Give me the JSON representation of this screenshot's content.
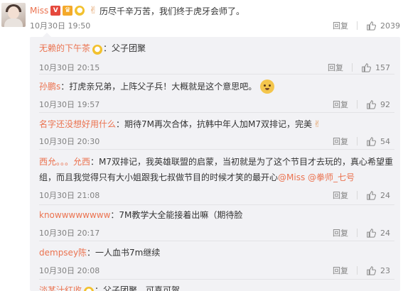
{
  "main_comment": {
    "user": "Miss",
    "text": "历尽千辛万苦，我们终于虎牙会师了。",
    "time": "10月30日 19:50",
    "reply_label": "回复",
    "likes": "2039",
    "badge_v": "V"
  },
  "replies": [
    {
      "user": "无赖的下午茶",
      "text": "：父子团聚",
      "time": "10月30日 20:15",
      "reply_label": "回复",
      "likes": "157"
    },
    {
      "user": "孙鹏s",
      "text": "：打虎亲兄弟，上阵父子兵！大概就是这个意思吧。",
      "time": "10月30日 19:57",
      "reply_label": "回复",
      "likes": "92"
    },
    {
      "user": "名字还没想好用什么",
      "text": "：期待7M再次合体，抗韩中年人加M7双排记，完美",
      "time": "10月30日 20:30",
      "reply_label": "回复",
      "likes": "54"
    },
    {
      "user": "西允。。。允西",
      "text_line1": "：M7双排记，我英雄联盟的启蒙，当初就是为了这个节目才去玩的，真心希望重",
      "text_line2": "组，而且我觉得只有大小姐跟我七叔做节目的时候才笑的最开心",
      "mention1": "@Miss",
      "mention2": "@拳师_七号",
      "time": "10月30日 21:08",
      "reply_label": "回复",
      "likes": "24"
    },
    {
      "user": "knowwwwwwww",
      "text": "：7M教学大全能接着出嘛（期待脸",
      "time": "10月30日 20:17",
      "reply_label": "回复",
      "likes": "24"
    },
    {
      "user": "dempsey陈",
      "text": "：一人血书7m继续",
      "time": "10月30日 20:08",
      "reply_label": "回复",
      "likes": "23"
    },
    {
      "user": "淡某汁红收",
      "text": "：父子团聚，可喜可贺"
    }
  ],
  "icons": {
    "thumb": "thumbs-up-icon",
    "emoji_victory": "victory-hand-icon",
    "emoji_doge": "doge-face-icon"
  },
  "colors": {
    "username": "#eb7350",
    "meta": "#808080",
    "reply_bg": "#f2f2f5"
  }
}
